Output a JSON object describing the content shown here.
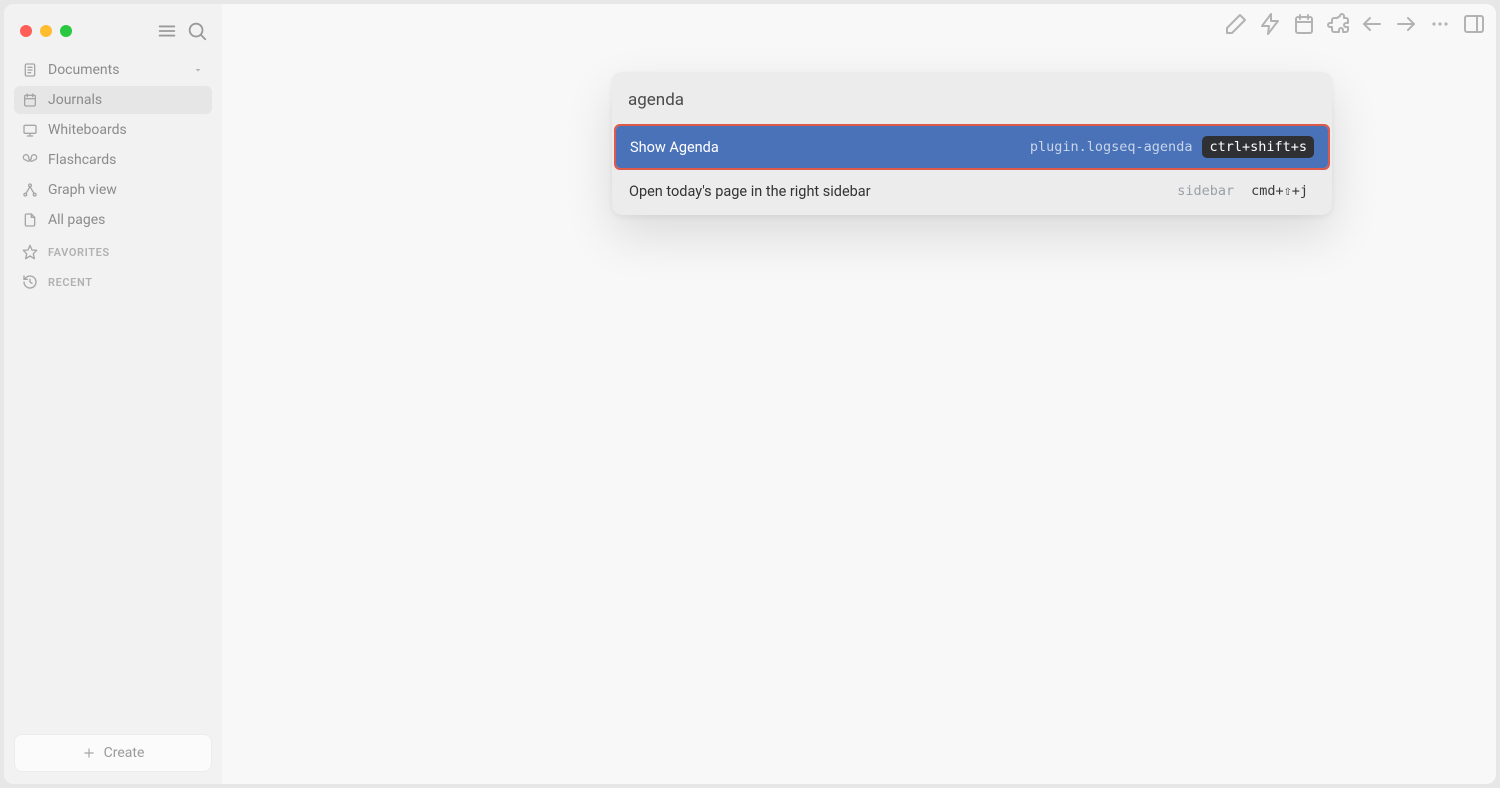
{
  "sidebar": {
    "items": [
      {
        "label": "Documents",
        "has_chevron": true
      },
      {
        "label": "Journals"
      },
      {
        "label": "Whiteboards"
      },
      {
        "label": "Flashcards"
      },
      {
        "label": "Graph view"
      },
      {
        "label": "All pages"
      }
    ],
    "sections": {
      "favorites": "FAVORITES",
      "recent": "RECENT"
    },
    "create_label": "Create"
  },
  "palette": {
    "input_value": "agenda",
    "results": [
      {
        "title": "Show Agenda",
        "source": "plugin.logseq-agenda",
        "shortcut": "ctrl+shift+s",
        "selected": true
      },
      {
        "title": "Open today's page in the right sidebar",
        "source": "sidebar",
        "shortcut": "cmd+⇧+j",
        "selected": false
      }
    ]
  }
}
